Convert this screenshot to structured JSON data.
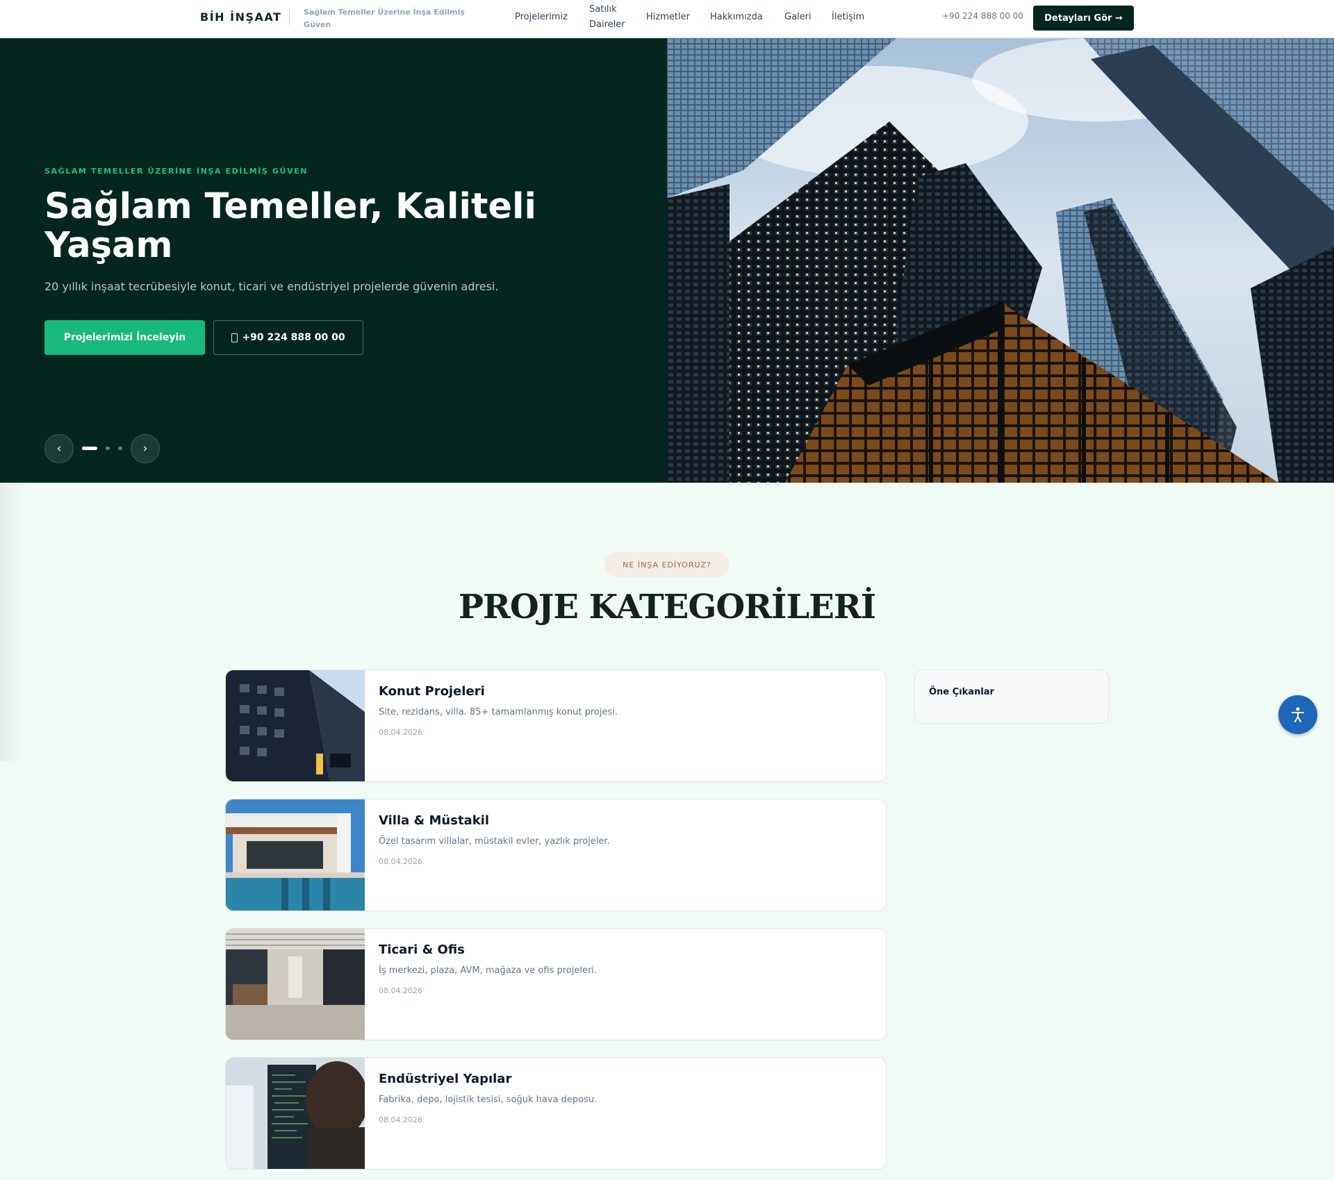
{
  "nav": {
    "brand": "BİH İNŞAAT",
    "tagline": "Sağlam Temeller Üzerine İnşa Edilmiş Güven",
    "items": [
      "Projelerimiz",
      "Satılık Daireler",
      "Hizmetler",
      "Hakkımızda",
      "Galeri",
      "İletişim"
    ],
    "phone": "+90 224 888 00 00",
    "cta": "Detayları Gör →"
  },
  "hero": {
    "eyebrow": "SAĞLAM TEMELLER ÜZERİNE İNŞA EDİLMİŞ GÜVEN",
    "title": "Sağlam Temeller, Kaliteli Yaşam",
    "subtitle": "20 yıllık inşaat tecrübesiyle konut, ticari ve endüstriyel projelerde güvenin adresi.",
    "primary_button": "Projelerimizi İnceleyin",
    "phone_button": "+90 224 888 00 00",
    "prev": "‹",
    "next": "›",
    "slides_total": 3,
    "active_slide": 1
  },
  "section": {
    "badge": "NE İNŞA EDİYORUZ?",
    "title": "PROJE KATEGORİLERİ",
    "sidebar_title": "Öne Çıkanlar"
  },
  "categories": [
    {
      "title": "Konut Projeleri",
      "description": "Site, rezidans, villa. 85+ tamamlanmış konut projesi.",
      "date": "08.04.2026"
    },
    {
      "title": "Villa & Müstakil",
      "description": "Özel tasarım villalar, müstakil evler, yazlık projeler.",
      "date": "08.04.2026"
    },
    {
      "title": "Ticari & Ofis",
      "description": "İş merkezi, plaza, AVM, mağaza ve ofis projeleri.",
      "date": "08.04.2026"
    },
    {
      "title": "Endüstriyel Yapılar",
      "description": "Fabrika, depo, lojistik tesisi, soğuk hava deposu.",
      "date": "08.04.2026"
    }
  ],
  "colors": {
    "hero_bg": "#03271f",
    "accent": "#18b97d",
    "page_bg": "#effbf4",
    "a11y_button": "#1e66b8"
  }
}
